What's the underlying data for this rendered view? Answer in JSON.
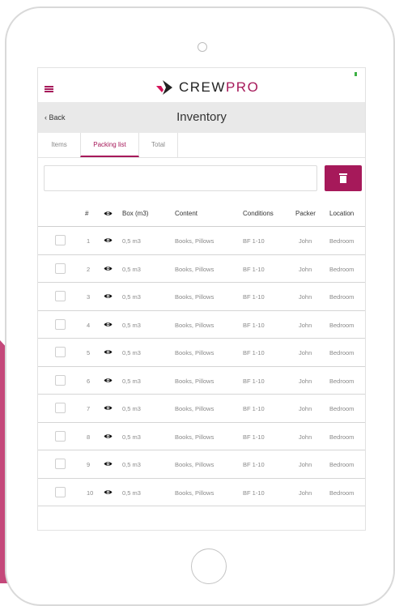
{
  "app": {
    "logo_word": "CREW",
    "logo_accent": "PRO",
    "brand_color": "#a6195a"
  },
  "header": {
    "back_label": "Back",
    "title": "Inventory"
  },
  "tabs": [
    {
      "label": "Items",
      "active": false
    },
    {
      "label": "Packing list",
      "active": true
    },
    {
      "label": "Total",
      "active": false
    }
  ],
  "search": {
    "value": "",
    "placeholder": ""
  },
  "table": {
    "headers": {
      "num": "#",
      "box": "Box (m3)",
      "content": "Content",
      "conditions": "Conditions",
      "packer": "Packer",
      "location": "Location"
    },
    "rows": [
      {
        "num": "1",
        "box": "0,5 m3",
        "content": "Books, Pillows",
        "conditions": "BF 1-10",
        "packer": "John",
        "location": "Bedroom"
      },
      {
        "num": "2",
        "box": "0,5 m3",
        "content": "Books, Pillows",
        "conditions": "BF 1-10",
        "packer": "John",
        "location": "Bedroom"
      },
      {
        "num": "3",
        "box": "0,5 m3",
        "content": "Books, Pillows",
        "conditions": "BF 1-10",
        "packer": "John",
        "location": "Bedroom"
      },
      {
        "num": "4",
        "box": "0,5 m3",
        "content": "Books, Pillows",
        "conditions": "BF 1-10",
        "packer": "John",
        "location": "Bedroom"
      },
      {
        "num": "5",
        "box": "0,5 m3",
        "content": "Books, Pillows",
        "conditions": "BF 1-10",
        "packer": "John",
        "location": "Bedroom"
      },
      {
        "num": "6",
        "box": "0,5 m3",
        "content": "Books, Pillows",
        "conditions": "BF 1-10",
        "packer": "John",
        "location": "Bedroom"
      },
      {
        "num": "7",
        "box": "0,5 m3",
        "content": "Books, Pillows",
        "conditions": "BF 1-10",
        "packer": "John",
        "location": "Bedroom"
      },
      {
        "num": "8",
        "box": "0,5 m3",
        "content": "Books, Pillows",
        "conditions": "BF 1-10",
        "packer": "John",
        "location": "Bedroom"
      },
      {
        "num": "9",
        "box": "0,5 m3",
        "content": "Books, Pillows",
        "conditions": "BF 1-10",
        "packer": "John",
        "location": "Bedroom"
      },
      {
        "num": "10",
        "box": "0,5 m3",
        "content": "Books, Pillows",
        "conditions": "BF 1-10",
        "packer": "John",
        "location": "Bedroom"
      }
    ]
  }
}
